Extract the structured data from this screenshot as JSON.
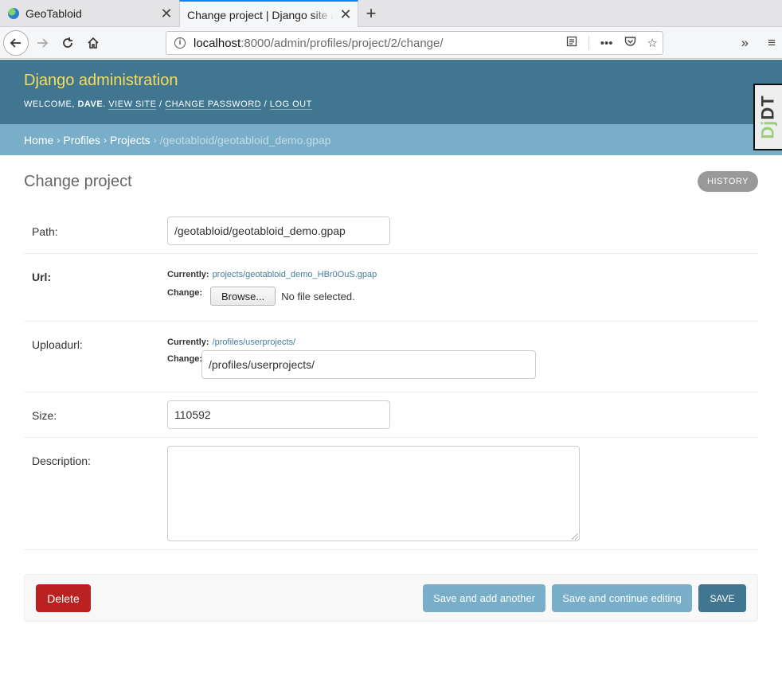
{
  "browser": {
    "tabs": [
      {
        "title": "GeoTabloid",
        "active": false
      },
      {
        "title": "Change project | Django site admin",
        "active": true
      }
    ],
    "url": {
      "host": "localhost",
      "rest": ":8000/admin/profiles/project/2/change/"
    }
  },
  "header": {
    "site_name": "Django administration",
    "welcome": "Welcome,",
    "username": "Dave",
    "view_site": "View site",
    "change_password": "Change password",
    "log_out": "Log out"
  },
  "debug_toolbar": {
    "label": "DJDT"
  },
  "breadcrumbs": {
    "home": "Home",
    "profiles": "Profiles",
    "projects": "Projects",
    "current": "/geotabloid/geotabloid_demo.gpap"
  },
  "page": {
    "title": "Change project",
    "history": "History"
  },
  "form": {
    "path": {
      "label": "Path:",
      "value": "/geotabloid/geotabloid_demo.gpap"
    },
    "url": {
      "label": "Url:",
      "currently_label": "Currently:",
      "currently_value": "projects/geotabloid_demo_HBr0OuS.gpap",
      "change_label": "Change:",
      "browse": "Browse...",
      "no_file": "No file selected."
    },
    "uploadurl": {
      "label": "Uploadurl:",
      "currently_label": "Currently:",
      "currently_value": "/profiles/userprojects/",
      "change_label": "Change:",
      "value": "/profiles/userprojects/"
    },
    "size": {
      "label": "Size:",
      "value": "110592"
    },
    "description": {
      "label": "Description:",
      "value": ""
    }
  },
  "actions": {
    "delete": "Delete",
    "save_add_another": "Save and add another",
    "save_continue": "Save and continue editing",
    "save": "Save"
  },
  "colors": {
    "header_bg": "#417690",
    "breadcrumbs_bg": "#79aec8",
    "site_name": "#f5dd5d",
    "delete_bg": "#ba2121"
  }
}
